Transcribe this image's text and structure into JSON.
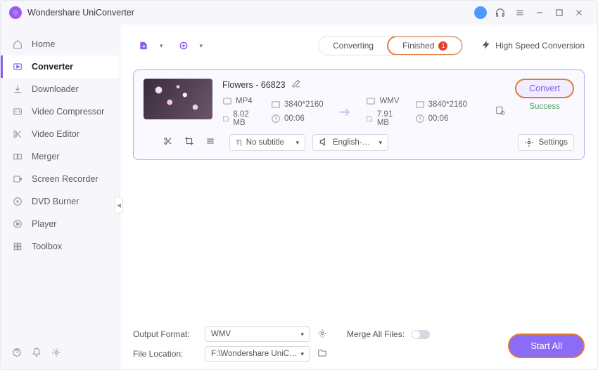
{
  "app": {
    "title": "Wondershare UniConverter"
  },
  "sidebar": {
    "items": [
      {
        "label": "Home"
      },
      {
        "label": "Converter"
      },
      {
        "label": "Downloader"
      },
      {
        "label": "Video Compressor"
      },
      {
        "label": "Video Editor"
      },
      {
        "label": "Merger"
      },
      {
        "label": "Screen Recorder"
      },
      {
        "label": "DVD Burner"
      },
      {
        "label": "Player"
      },
      {
        "label": "Toolbox"
      }
    ]
  },
  "tabs": {
    "converting": "Converting",
    "finished": "Finished",
    "finished_count": "1"
  },
  "hispeed": {
    "label": "High Speed Conversion"
  },
  "file": {
    "name": "Flowers - 66823",
    "src": {
      "format": "MP4",
      "res": "3840*2160",
      "size": "8.02 MB",
      "dur": "00:06"
    },
    "dst": {
      "format": "WMV",
      "res": "3840*2160",
      "size": "7.91 MB",
      "dur": "00:06"
    },
    "subtitle": "No subtitle",
    "audio": "English-Advan...",
    "settings_label": "Settings",
    "convert_label": "Convert",
    "status": "Success"
  },
  "footer": {
    "out_label": "Output Format:",
    "out_value": "WMV",
    "loc_label": "File Location:",
    "loc_value": "F:\\Wondershare UniConverter",
    "merge_label": "Merge All Files:",
    "startall": "Start All"
  }
}
